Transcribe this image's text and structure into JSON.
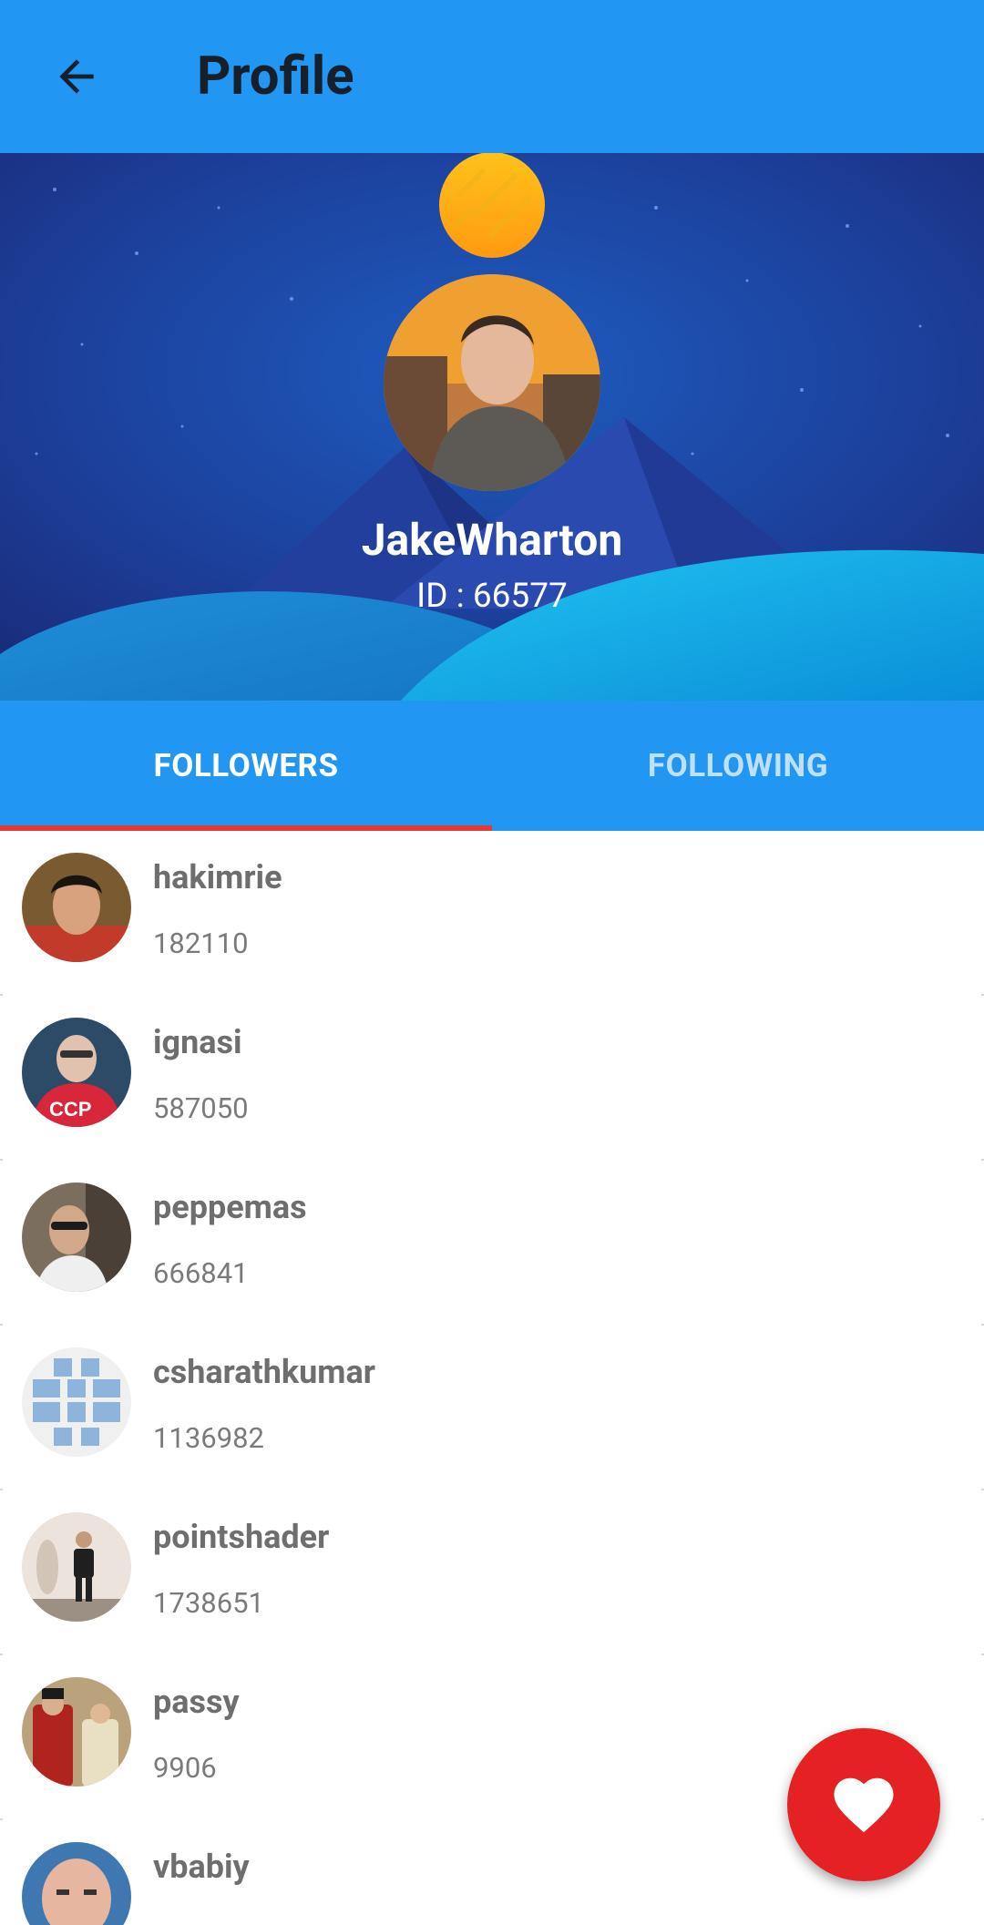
{
  "appbar": {
    "title": "Profile",
    "back_icon": "arrow-back-icon"
  },
  "profile": {
    "name": "JakeWharton",
    "id_text": "ID : 66577"
  },
  "tabs": [
    {
      "label": "FOLLOWERS",
      "active": true
    },
    {
      "label": "FOLLOWING",
      "active": false
    }
  ],
  "followers": [
    {
      "name": "hakimrie",
      "count": "182110"
    },
    {
      "name": "ignasi",
      "count": "587050"
    },
    {
      "name": "peppemas",
      "count": "666841"
    },
    {
      "name": "csharathkumar",
      "count": "1136982"
    },
    {
      "name": "pointshader",
      "count": "1738651"
    },
    {
      "name": "passy",
      "count": "9906"
    },
    {
      "name": "vbabiy",
      "count": ""
    }
  ],
  "fab": {
    "icon": "heart-icon"
  },
  "colors": {
    "primary": "#2196F3",
    "accent": "#E52124",
    "tab_indicator": "#E53935"
  }
}
